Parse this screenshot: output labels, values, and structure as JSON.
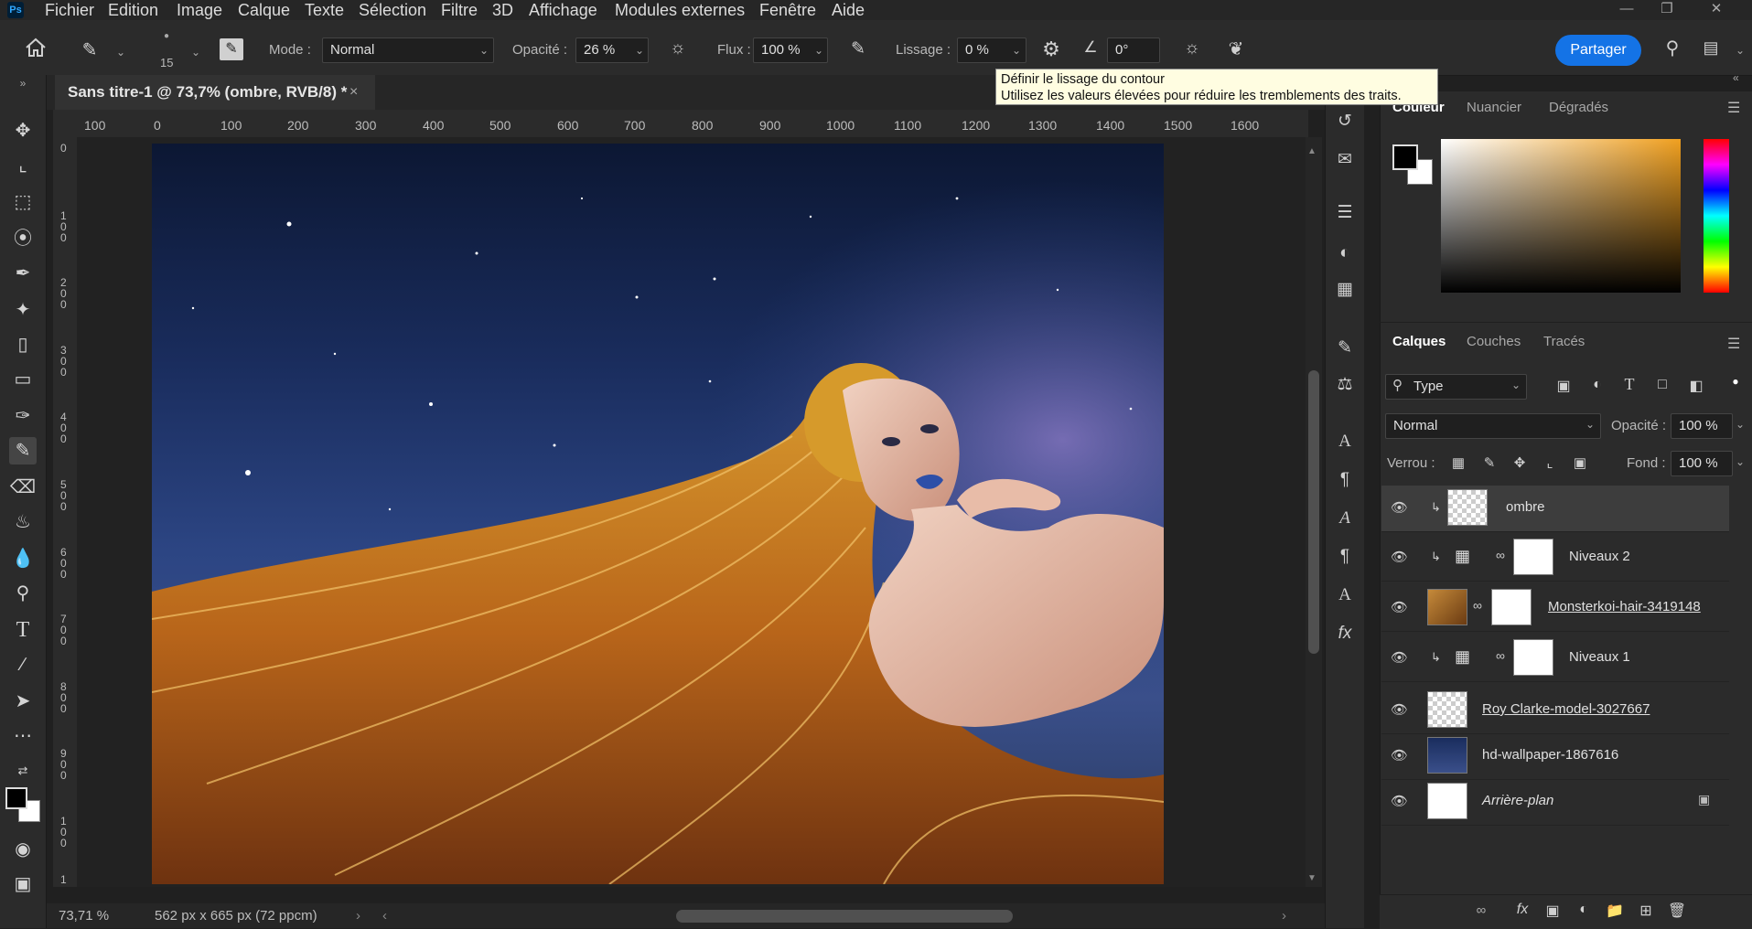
{
  "app": {
    "logo": "Ps"
  },
  "menu": [
    "Fichier",
    "Edition",
    "Image",
    "Calque",
    "Texte",
    "Sélection",
    "Filtre",
    "3D",
    "Affichage",
    "Modules externes",
    "Fenêtre",
    "Aide"
  ],
  "options": {
    "brush_size": "15",
    "mode_label": "Mode :",
    "mode_value": "Normal",
    "opacity_label": "Opacité :",
    "opacity_value": "26 %",
    "flow_label": "Flux :",
    "flow_value": "100 %",
    "smoothing_label": "Lissage :",
    "smoothing_value": "0 %",
    "angle_value": "0°",
    "share_label": "Partager"
  },
  "tooltip": {
    "line1": "Définir le lissage du contour",
    "line2": "Utilisez les valeurs élevées pour réduire les tremblements des traits."
  },
  "document": {
    "tab_title": "Sans titre-1 @ 73,7% (ombre, RVB/8) *",
    "zoom": "73,71 %",
    "info": "562 px x 665 px (72 ppcm)"
  },
  "ruler": {
    "h_labels": [
      "100",
      "0",
      "100",
      "200",
      "300",
      "400",
      "500",
      "600",
      "700",
      "800",
      "900",
      "1000",
      "1100",
      "1200",
      "1300",
      "1400",
      "1500",
      "1600"
    ],
    "v_labels": [
      "0",
      "1\n0\n0",
      "2\n0\n0",
      "3\n0\n0",
      "4\n0\n0",
      "5\n0\n0",
      "6\n0\n0",
      "7\n0\n0",
      "8\n0\n0",
      "9\n0\n0",
      "1\n0\n0",
      "1"
    ]
  },
  "color_panel": {
    "tabs": [
      "Couleur",
      "Nuancier",
      "Dégradés"
    ]
  },
  "layers_panel": {
    "tabs": [
      "Calques",
      "Couches",
      "Tracés"
    ],
    "filter_value": "Type",
    "blend_mode": "Normal",
    "opacity_label": "Opacité :",
    "opacity_value": "100 %",
    "lock_label": "Verrou :",
    "fill_label": "Fond :",
    "fill_value": "100 %",
    "layers": [
      {
        "name": "ombre",
        "selected": true
      },
      {
        "name": "Niveaux 2",
        "selected": false
      },
      {
        "name": "Monsterkoi-hair-3419148",
        "selected": false
      },
      {
        "name": "Niveaux 1",
        "selected": false
      },
      {
        "name": "Roy Clarke-model-3027667",
        "selected": false
      },
      {
        "name": "hd-wallpaper-1867616",
        "selected": false
      },
      {
        "name": "Arrière-plan",
        "selected": false
      }
    ]
  },
  "colors": {
    "accent": "#1473e6",
    "foreground": "#000000",
    "background": "#ffffff"
  }
}
